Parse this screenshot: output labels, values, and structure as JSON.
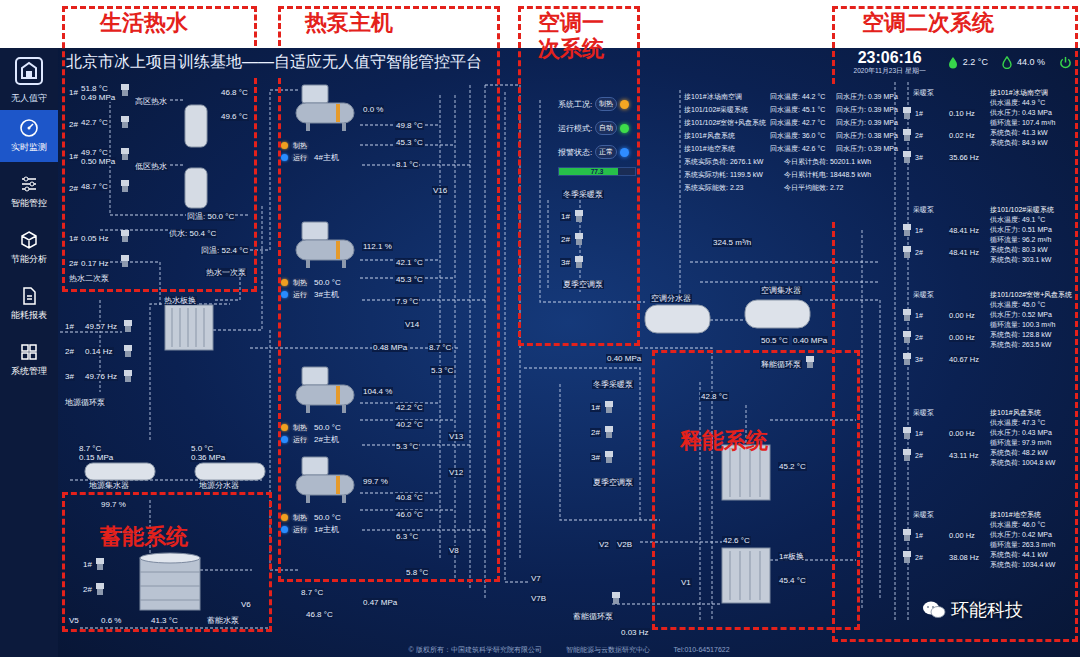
{
  "annotations": [
    {
      "label": "生活热水"
    },
    {
      "label": "热泵主机"
    },
    {
      "label": "空调一次系统"
    },
    {
      "label": "空调二次系统"
    },
    {
      "label": "释能系统"
    },
    {
      "label": "蓄能系统"
    }
  ],
  "sidebar": {
    "caption": "无人值守",
    "items": [
      {
        "label": "实时监测",
        "selected": true
      },
      {
        "label": "智能管控",
        "selected": false
      },
      {
        "label": "节能分析",
        "selected": false
      },
      {
        "label": "能耗报表",
        "selected": false
      },
      {
        "label": "系统管理",
        "selected": false
      }
    ]
  },
  "header": {
    "title": "北京市冰上项目训练基地——自适应无人值守智能管控平台",
    "time": "23:06:16",
    "date": "2020年11月23日 星期一",
    "temperature": "2.2 °C",
    "humidity": "44.0 %"
  },
  "status_panel": {
    "rows": [
      {
        "label": "系统工况:",
        "value": "制热",
        "color": "#f5a623"
      },
      {
        "label": "运行模式:",
        "value": "自动",
        "color": "#3ddc4a"
      },
      {
        "label": "报警状态:",
        "value": "正常",
        "color": "#2f8cff"
      }
    ],
    "progress": {
      "text": "77.3",
      "level": 0.77
    }
  },
  "heat_pumps": [
    {
      "name": "4#主机",
      "mode": "制热",
      "state": "运行",
      "load": "0.0 %",
      "temps": [
        "49.8 °C",
        "45.3 °C",
        "8.1 °C"
      ]
    },
    {
      "name": "3#主机",
      "mode": "制热",
      "state": "运行",
      "load": "112.1 %",
      "setpoint": "50.0 °C",
      "temps": [
        "42.1 °C",
        "45.3 °C",
        "7.9 °C"
      ]
    },
    {
      "name": "2#主机",
      "mode": "制热",
      "state": "运行",
      "load": "104.4 %",
      "setpoint": "50.0 °C",
      "temps": [
        "42.2 °C",
        "40.2 °C",
        "5.3 °C"
      ]
    },
    {
      "name": "1#主机",
      "mode": "制热",
      "state": "运行",
      "load": "99.7 %",
      "setpoint": "50.0 °C",
      "temps": [
        "40.8 °C",
        "46.0 °C",
        "6.3 °C"
      ]
    }
  ],
  "diagram_labels": {
    "hot_water": [
      "1#",
      "51.8 °C",
      "0.49 MPa",
      "2#",
      "42.7 °C",
      "高区热水",
      "1#",
      "49.7 °C",
      "0.50 MPa",
      "2#",
      "48.7 °C",
      "低区热水",
      "回温: 50.0 °C",
      "供水: 50.4 °C",
      "回温: 52.4 °C",
      "1#",
      "0.05 Hz",
      "2#",
      "0.17 Hz",
      "热水二次泵",
      "热水板换",
      "热水一次泵",
      "46.8 °C",
      "49.6 °C"
    ],
    "ground": [
      "1#",
      "49.57 Hz",
      "2#",
      "0.14 Hz",
      "3#",
      "49.76 Hz",
      "地源循环泵",
      "8.7 °C",
      "0.15 MPa",
      "5.0 °C",
      "0.36 MPa",
      "地源集水器",
      "地源分水器"
    ],
    "hp_pipes": [
      "V16",
      "V14",
      "0.48 MPa",
      "8.7 °C",
      "5.3 °C",
      "V13",
      "V12",
      "V8",
      "5.8 °C",
      "8.7 °C",
      "0.47 MPa",
      "46.8 °C"
    ],
    "primary": [
      "冬季采暖泵",
      "1#",
      "2#",
      "3#",
      "夏季空调泵",
      "空调分水器",
      "0.40 MPa",
      "324.5 m³/h",
      "空调集水器",
      "50.5 °C",
      "0.40 MPa",
      "冬季采暖泵",
      "1#",
      "2#",
      "3#",
      "夏季空调泵",
      "V2",
      "V2B",
      "V7",
      "V7B",
      "蓄能循环泵",
      "0.03 Hz"
    ],
    "release": [
      "释能循环泵",
      "42.8 °C",
      "45.2 °C",
      "42.6 °C",
      "1#板换",
      "45.4 °C",
      "V1"
    ],
    "storage": [
      "99.7 %",
      "1#",
      "2#",
      "V5",
      "0.6 %",
      "41.3 °C",
      "蓄能水泵",
      "V6"
    ]
  },
  "summary": {
    "rows": [
      {
        "name": "接101#冰场南空调",
        "temp": "回水温度: 44.2 °C",
        "pressure": "回水压力: 0.39 MPa"
      },
      {
        "name": "接101/102#采暖系统",
        "temp": "回水温度: 45.1 °C",
        "pressure": "回水压力: 0.39 MPa"
      },
      {
        "name": "接101/102#室馆+风盘系统",
        "temp": "回水温度: 42.7 °C",
        "pressure": "回水压力: 0.39 MPa"
      },
      {
        "name": "接101#风盘系统",
        "temp": "回水温度: 36.0 °C",
        "pressure": "回水压力: 0.38 MPa"
      },
      {
        "name": "接101#地空系统",
        "temp": "回水温度: 42.6 °C",
        "pressure": "回水压力: 0.39 MPa"
      }
    ],
    "energy": [
      {
        "now": "系统实际负荷: 2676.1 kW",
        "today": "今日累计负荷: 50201.1 kWh"
      },
      {
        "now": "系统实际功耗: 1199.5 kW",
        "today": "今日累计耗电: 18448.5 kWh"
      },
      {
        "now": "系统实际能效: 2.23",
        "today": "今日平均能效: 2.72"
      }
    ]
  },
  "branches": [
    {
      "name": "接101#冰场南空调",
      "pump_group": "采暖泵",
      "pumps": [
        {
          "label": "1#",
          "hz": "0.10 Hz"
        },
        {
          "label": "2#",
          "hz": "0.02 Hz"
        },
        {
          "label": "3#",
          "hz": "35.66 Hz"
        }
      ],
      "lines": [
        "供水温度: 44.9 °C",
        "供水压力: 0.43 MPa",
        "循环流量: 107.4 m³/h",
        "系统负荷: 41.3 kW",
        "系统负荷: 84.9 kW"
      ]
    },
    {
      "name": "接101/102#采暖系统",
      "pump_group": "采暖泵",
      "pumps": [
        {
          "label": "1#",
          "hz": "48.41 Hz"
        },
        {
          "label": "2#",
          "hz": "48.41 Hz"
        }
      ],
      "lines": [
        "供水温度: 49.1 °C",
        "供水压力: 0.51 MPa",
        "循环流量: 96.2 m³/h",
        "系统负荷: 80.3 kW",
        "系统负荷: 303.1 kW"
      ]
    },
    {
      "name": "接101/102#室馆+风盘系统",
      "pump_group": "采暖泵",
      "pumps": [
        {
          "label": "1#",
          "hz": "0.00 Hz"
        },
        {
          "label": "2#",
          "hz": "0.00 Hz"
        },
        {
          "label": "3#",
          "hz": "40.67 Hz"
        }
      ],
      "lines": [
        "供水温度: 45.0 °C",
        "供水压力: 0.52 MPa",
        "循环流量: 100.3 m³/h",
        "系统负荷: 128.8 kW",
        "系统负荷: 263.5 kW"
      ]
    },
    {
      "name": "接101#风盘系统",
      "pump_group": "采暖泵",
      "pumps": [
        {
          "label": "1#",
          "hz": "0.00 Hz"
        },
        {
          "label": "2#",
          "hz": "43.11 Hz"
        }
      ],
      "lines": [
        "供水温度: 47.3 °C",
        "供水压力: 0.43 MPa",
        "循环流量: 97.9 m³/h",
        "系统负荷: 48.2 kW",
        "系统负荷: 1004.8 kW"
      ]
    },
    {
      "name": "接101#地空系统",
      "pump_group": "采暖泵",
      "pumps": [
        {
          "label": "1#",
          "hz": "0.00 Hz"
        },
        {
          "label": "2#",
          "hz": "38.08 Hz"
        }
      ],
      "lines": [
        "供水温度: 46.0 °C",
        "供水压力: 0.42 MPa",
        "循环流量: 263.3 m³/h",
        "系统负荷: 44.1 kW",
        "系统负荷: 1034.4 kW"
      ]
    }
  ],
  "footer": [
    "© 版权所有：中国建筑科学研究院有限公司",
    "智能能源与云数据研究中心",
    "Tel:010-64517622"
  ],
  "watermark": "环能科技"
}
